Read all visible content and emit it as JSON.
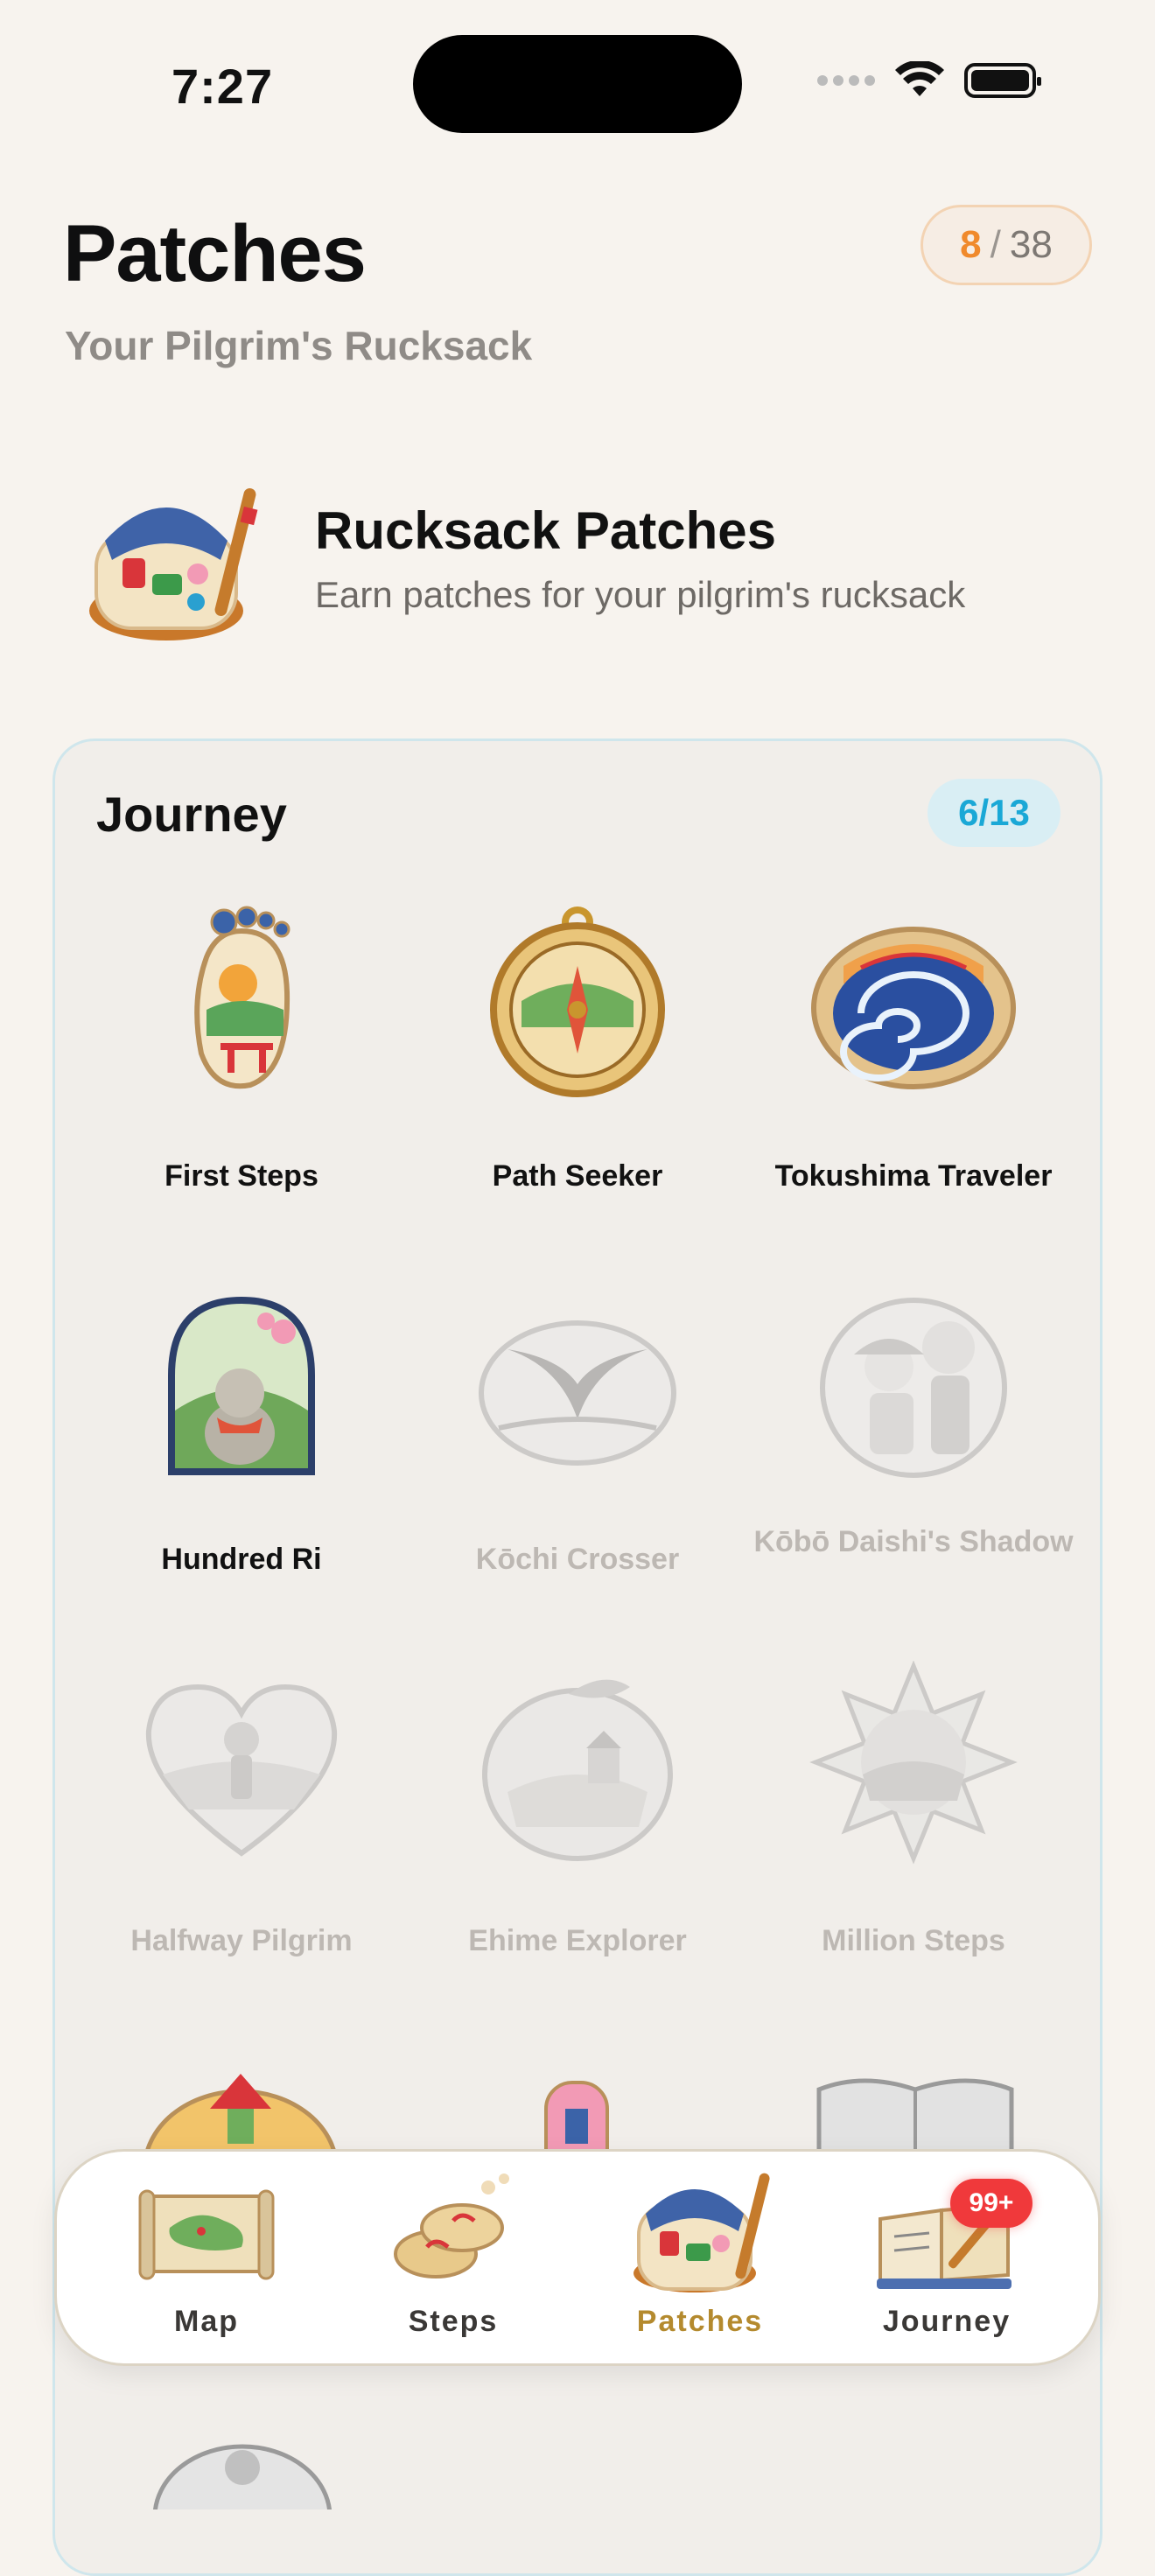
{
  "status_bar": {
    "time": "7:27"
  },
  "header": {
    "title": "Patches",
    "subtitle": "Your Pilgrim's Rucksack",
    "earned": "8",
    "separator": "/",
    "total": "38"
  },
  "section": {
    "title": "Rucksack Patches",
    "subtitle": "Earn patches for your pilgrim's rucksack",
    "icon": "backpack-icon"
  },
  "journey": {
    "title": "Journey",
    "count": "6/13",
    "patches": [
      {
        "name": "First Steps",
        "earned": true,
        "icon": "footprint-patch-icon"
      },
      {
        "name": "Path Seeker",
        "earned": true,
        "icon": "compass-patch-icon"
      },
      {
        "name": "Tokushima Traveler",
        "earned": true,
        "icon": "whirlpool-patch-icon"
      },
      {
        "name": "Hundred Ri",
        "earned": true,
        "icon": "jizo-patch-icon"
      },
      {
        "name": "Kōchi Crosser",
        "earned": false,
        "icon": "whale-patch-icon"
      },
      {
        "name": "Kōbō Daishi's Shadow",
        "earned": false,
        "icon": "monk-patch-icon"
      },
      {
        "name": "Halfway Pilgrim",
        "earned": false,
        "icon": "heart-pilgrim-patch-icon"
      },
      {
        "name": "Ehime Explorer",
        "earned": false,
        "icon": "citrus-patch-icon"
      },
      {
        "name": "Million Steps",
        "earned": false,
        "icon": "sunburst-patch-icon"
      }
    ]
  },
  "tabs": [
    {
      "label": "Map",
      "icon": "scroll-map-icon",
      "active": false
    },
    {
      "label": "Steps",
      "icon": "sandals-icon",
      "active": false
    },
    {
      "label": "Patches",
      "icon": "backpack-icon",
      "active": true
    },
    {
      "label": "Journey",
      "icon": "journal-icon",
      "active": false,
      "badge": "99+"
    }
  ],
  "colors": {
    "accent_orange": "#f08a2c",
    "accent_blue": "#1aa8d6",
    "active_tab": "#b48a2e",
    "badge_red": "#f0393b"
  }
}
